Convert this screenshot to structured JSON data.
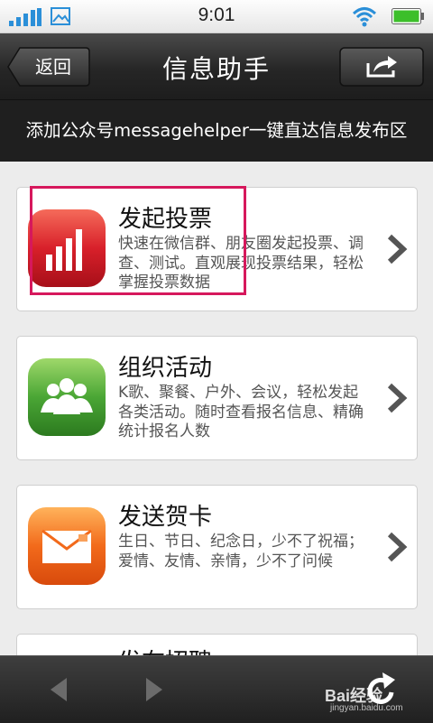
{
  "status_bar": {
    "time": "9:01"
  },
  "nav": {
    "back_label": "返回",
    "title": "信息助手"
  },
  "banner": {
    "text": "添加公众号messagehelper一键直达信息发布区"
  },
  "cards": [
    {
      "title": "发起投票",
      "desc": "快速在微信群、朋友圈发起投票、调查、测试。直观展现投票结果，轻松掌握投票数据",
      "icon": "bar-chart-icon",
      "color": "#e0282c"
    },
    {
      "title": "组织活动",
      "desc": "K歌、聚餐、户外、会议，轻松发起各类活动。随时查看报名信息、精确统计报名人数",
      "icon": "group-people-icon",
      "color": "#4aa635"
    },
    {
      "title": "发送贺卡",
      "desc": "生日、节日、纪念日，少不了祝福；爱情、友情、亲情，少不了问候",
      "icon": "envelope-icon",
      "color": "#f26a1b"
    },
    {
      "title": "发布招聘",
      "desc": "",
      "icon": "",
      "color": ""
    }
  ],
  "watermark": {
    "text": "Bai经验",
    "sub": "jingyan.baidu.com"
  }
}
